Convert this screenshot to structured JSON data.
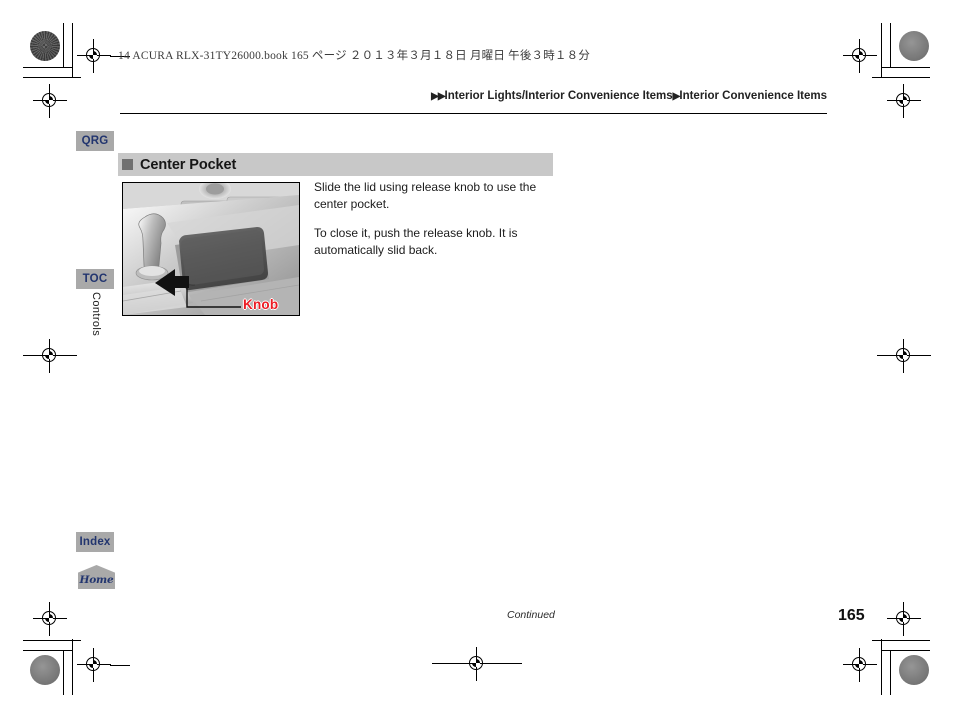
{
  "header": {
    "meta_line": "14 ACURA RLX-31TY26000.book   165 ページ   ２０１３年３月１８日   月曜日   午後３時１８分"
  },
  "breadcrumb": {
    "arrow_double": "▶▶",
    "level1": "Interior Lights/Interior Convenience Items",
    "arrow_single": "▶",
    "level2": "Interior Convenience Items"
  },
  "sidebar": {
    "qrg_label": "QRG",
    "toc_label": "TOC",
    "index_label": "Index",
    "home_label": "Home",
    "section_tab_label": "Controls"
  },
  "section": {
    "heading": "Center Pocket"
  },
  "body": {
    "paragraph1": "Slide the lid using release knob to use the center pocket.",
    "paragraph2": "To close it, push the release knob. It is automatically slid back."
  },
  "illustration": {
    "callout_label": "Knob",
    "callout_color": "#ec1c24",
    "alt": "Center console with shift lever and sliding center pocket lid, arrow pointing to release knob"
  },
  "footer": {
    "continued": "Continued",
    "page_number": "165"
  },
  "colors": {
    "tab_background": "#a9a9a9",
    "tab_text": "#22356f",
    "heading_bar": "#c8c8c8",
    "heading_bullet": "#707070",
    "callout_red": "#ec1c24"
  }
}
